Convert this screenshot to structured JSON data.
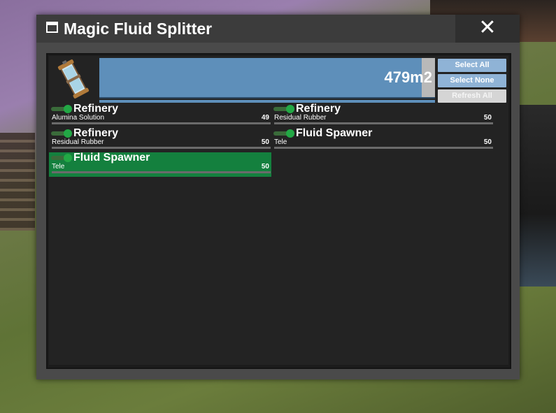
{
  "window": {
    "title": "Magic Fluid Splitter",
    "close_label": "✕"
  },
  "tank": {
    "icon": "fluid-tank-icon",
    "capacity_text": "479m2",
    "fill_level": 0.96
  },
  "buttons": {
    "select_all": "Select All",
    "select_none": "Select None",
    "refresh_all": "Refresh All"
  },
  "entries": [
    {
      "name": "Refinery",
      "fluid": "Alumina Solution",
      "amount": "49",
      "enabled": true,
      "selected": false
    },
    {
      "name": "Refinery",
      "fluid": "Residual Rubber",
      "amount": "50",
      "enabled": true,
      "selected": false
    },
    {
      "name": "Refinery",
      "fluid": "Residual Rubber",
      "amount": "50",
      "enabled": true,
      "selected": false
    },
    {
      "name": "Fluid Spawner",
      "fluid": "Tele",
      "amount": "50",
      "enabled": true,
      "selected": false
    },
    {
      "name": "Fluid Spawner",
      "fluid": "Tele",
      "amount": "50",
      "enabled": true,
      "selected": true
    }
  ],
  "colors": {
    "selected_row": "#14803e",
    "capacity_bar": "#5e8fba",
    "toggle_on": "#22a845",
    "button_blue": "#8fb3d6"
  }
}
